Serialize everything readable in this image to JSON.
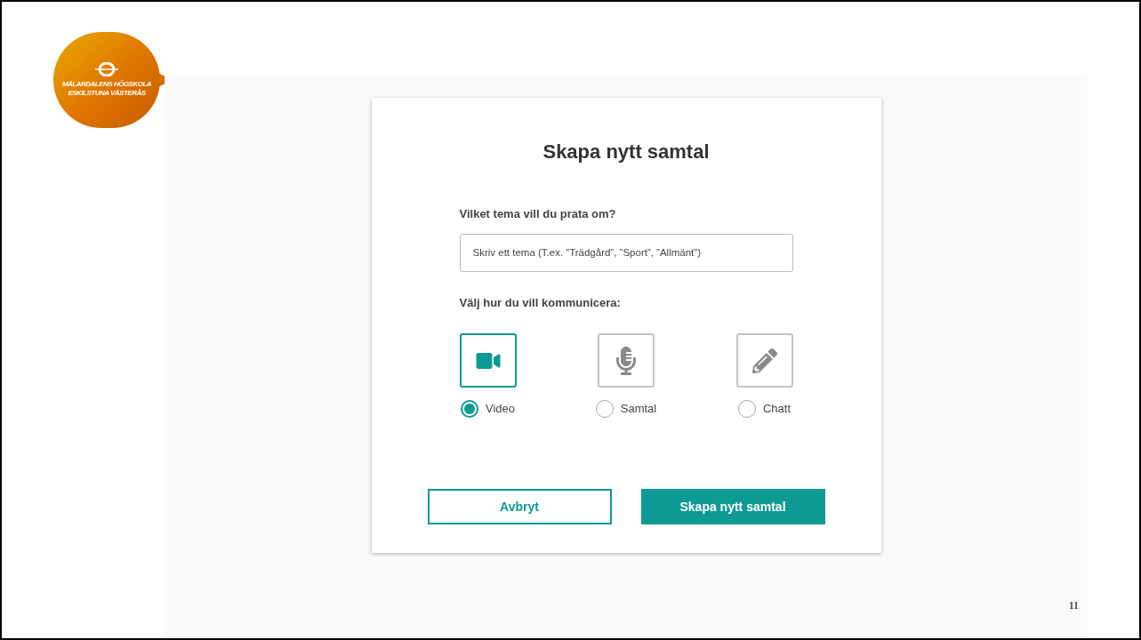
{
  "logo": {
    "lines": [
      "MÄLARDALENS HÖGSKOLA",
      "ESKILSTUNA VÄSTERÅS"
    ]
  },
  "dialog": {
    "title": "Skapa nytt samtal",
    "theme_label": "Vilket tema vill du prata om?",
    "theme_field": {
      "placeholder": "Skriv ett tema (T.ex. ”Trädgård”, ”Sport”, ”Allmänt”)"
    },
    "mode_label": "Välj hur du vill kommunicera:",
    "modes": [
      {
        "kind": "video",
        "label": "Video",
        "selected": true
      },
      {
        "kind": "voice",
        "label": "Samtal",
        "selected": false
      },
      {
        "kind": "chat",
        "label": "Chatt",
        "selected": false
      }
    ],
    "buttons": [
      {
        "kind": "secondary",
        "label": "Avbryt"
      },
      {
        "kind": "primary",
        "label": "Skapa nytt samtal"
      }
    ]
  },
  "page_number": "11"
}
